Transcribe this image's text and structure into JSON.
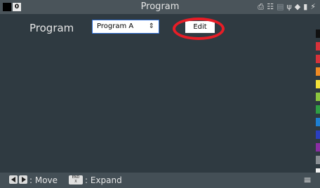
{
  "top_bar": {
    "title": "Program",
    "index_badge": "0",
    "status_icons": [
      "printer-icon",
      "wifi-icon",
      "network-icon",
      "usb-icon",
      "tool-icon",
      "sd-card-icon",
      "power-icon"
    ]
  },
  "main": {
    "program_label": "Program",
    "program_select": {
      "value": "Program A"
    },
    "edit_button_label": "Edit"
  },
  "color_strip": [
    "#111111",
    "#d7323a",
    "#d7323a",
    "#f08a24",
    "#f4e23a",
    "#8cc63f",
    "#2f9e44",
    "#1e7fd1",
    "#2b3fbf",
    "#8a2ea3",
    "#8a8f94",
    "#f2f2f2"
  ],
  "bottom_bar": {
    "move_label": ": Move",
    "end_key_top": "END",
    "end_key_bottom": "X",
    "expand_label": ": Expand"
  }
}
